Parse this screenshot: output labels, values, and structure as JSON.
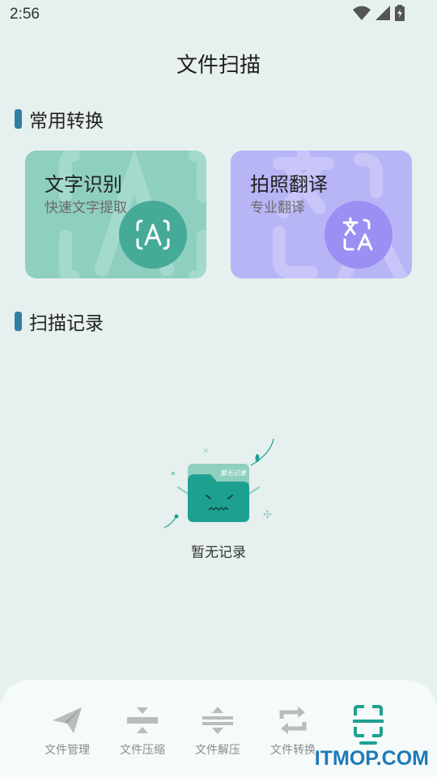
{
  "status": {
    "time": "2:56"
  },
  "page": {
    "title": "文件扫描"
  },
  "sections": {
    "common": "常用转换",
    "history": "扫描记录"
  },
  "cards": [
    {
      "title": "文字识别",
      "subtitle": "快速文字提取",
      "icon": "ocr-text-icon",
      "color": "#8fcfc0"
    },
    {
      "title": "拍照翻译",
      "subtitle": "专业翻译",
      "icon": "translate-icon",
      "color": "#b8b5f6"
    }
  ],
  "empty": {
    "text": "暂无记录",
    "badge": "暂无记录"
  },
  "nav": [
    {
      "label": "文件管理",
      "icon": "paper-plane-icon"
    },
    {
      "label": "文件压缩",
      "icon": "compress-icon"
    },
    {
      "label": "文件解压",
      "icon": "decompress-icon"
    },
    {
      "label": "文件转换",
      "icon": "convert-icon"
    },
    {
      "label": "",
      "icon": "scan-icon",
      "active": true
    }
  ],
  "watermark": "ITMOP.COM",
  "colors": {
    "accent": "#1ea090",
    "section_bar": "#2f7fa0",
    "background": "#e6f0ee"
  }
}
